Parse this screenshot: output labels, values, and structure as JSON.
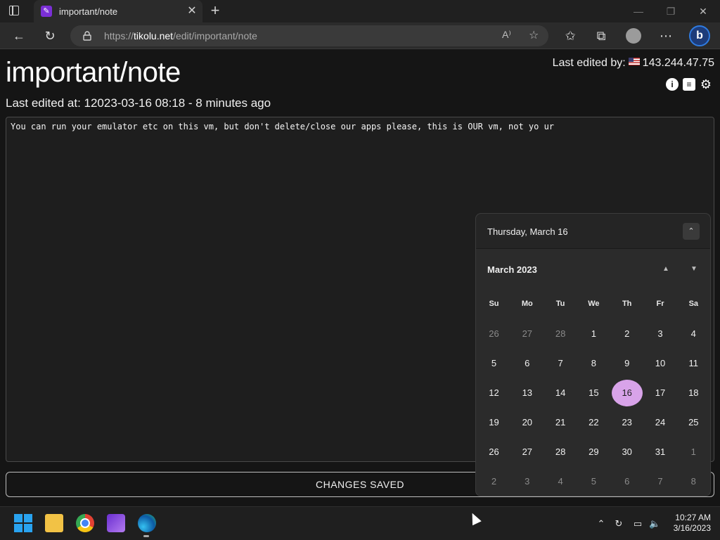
{
  "browser": {
    "tab_title": "important/note",
    "url_prefix": "https://",
    "url_domain": "tikolu.net",
    "url_path": "/edit/important/note"
  },
  "page": {
    "title": "important/note",
    "last_edited_at": "Last edited at: 12023-03-16  08:18 - 8 minutes ago",
    "last_edited_by_label": "Last edited by:",
    "last_edited_by_ip": "143.244.47.75",
    "note_text": "You can run your emulator etc on this vm, but don't delete/close our apps please, this is OUR vm, not yo ur",
    "save_status": "CHANGES SAVED"
  },
  "calendar": {
    "header_date": "Thursday, March 16",
    "month_label": "March 2023",
    "weekdays": [
      "Su",
      "Mo",
      "Tu",
      "We",
      "Th",
      "Fr",
      "Sa"
    ],
    "weeks": [
      [
        "26",
        "27",
        "28",
        "1",
        "2",
        "3",
        "4"
      ],
      [
        "5",
        "6",
        "7",
        "8",
        "9",
        "10",
        "11"
      ],
      [
        "12",
        "13",
        "14",
        "15",
        "16",
        "17",
        "18"
      ],
      [
        "19",
        "20",
        "21",
        "22",
        "23",
        "24",
        "25"
      ],
      [
        "26",
        "27",
        "28",
        "29",
        "30",
        "31",
        "1"
      ],
      [
        "2",
        "3",
        "4",
        "5",
        "6",
        "7",
        "8"
      ]
    ],
    "selected_day": "16",
    "selected_color": "#d8a3e9"
  },
  "taskbar": {
    "apps": [
      "start-icon",
      "file-explorer-icon",
      "chrome-icon",
      "visual-studio-icon",
      "edge-icon"
    ],
    "time": "10:27 AM",
    "date": "3/16/2023"
  }
}
